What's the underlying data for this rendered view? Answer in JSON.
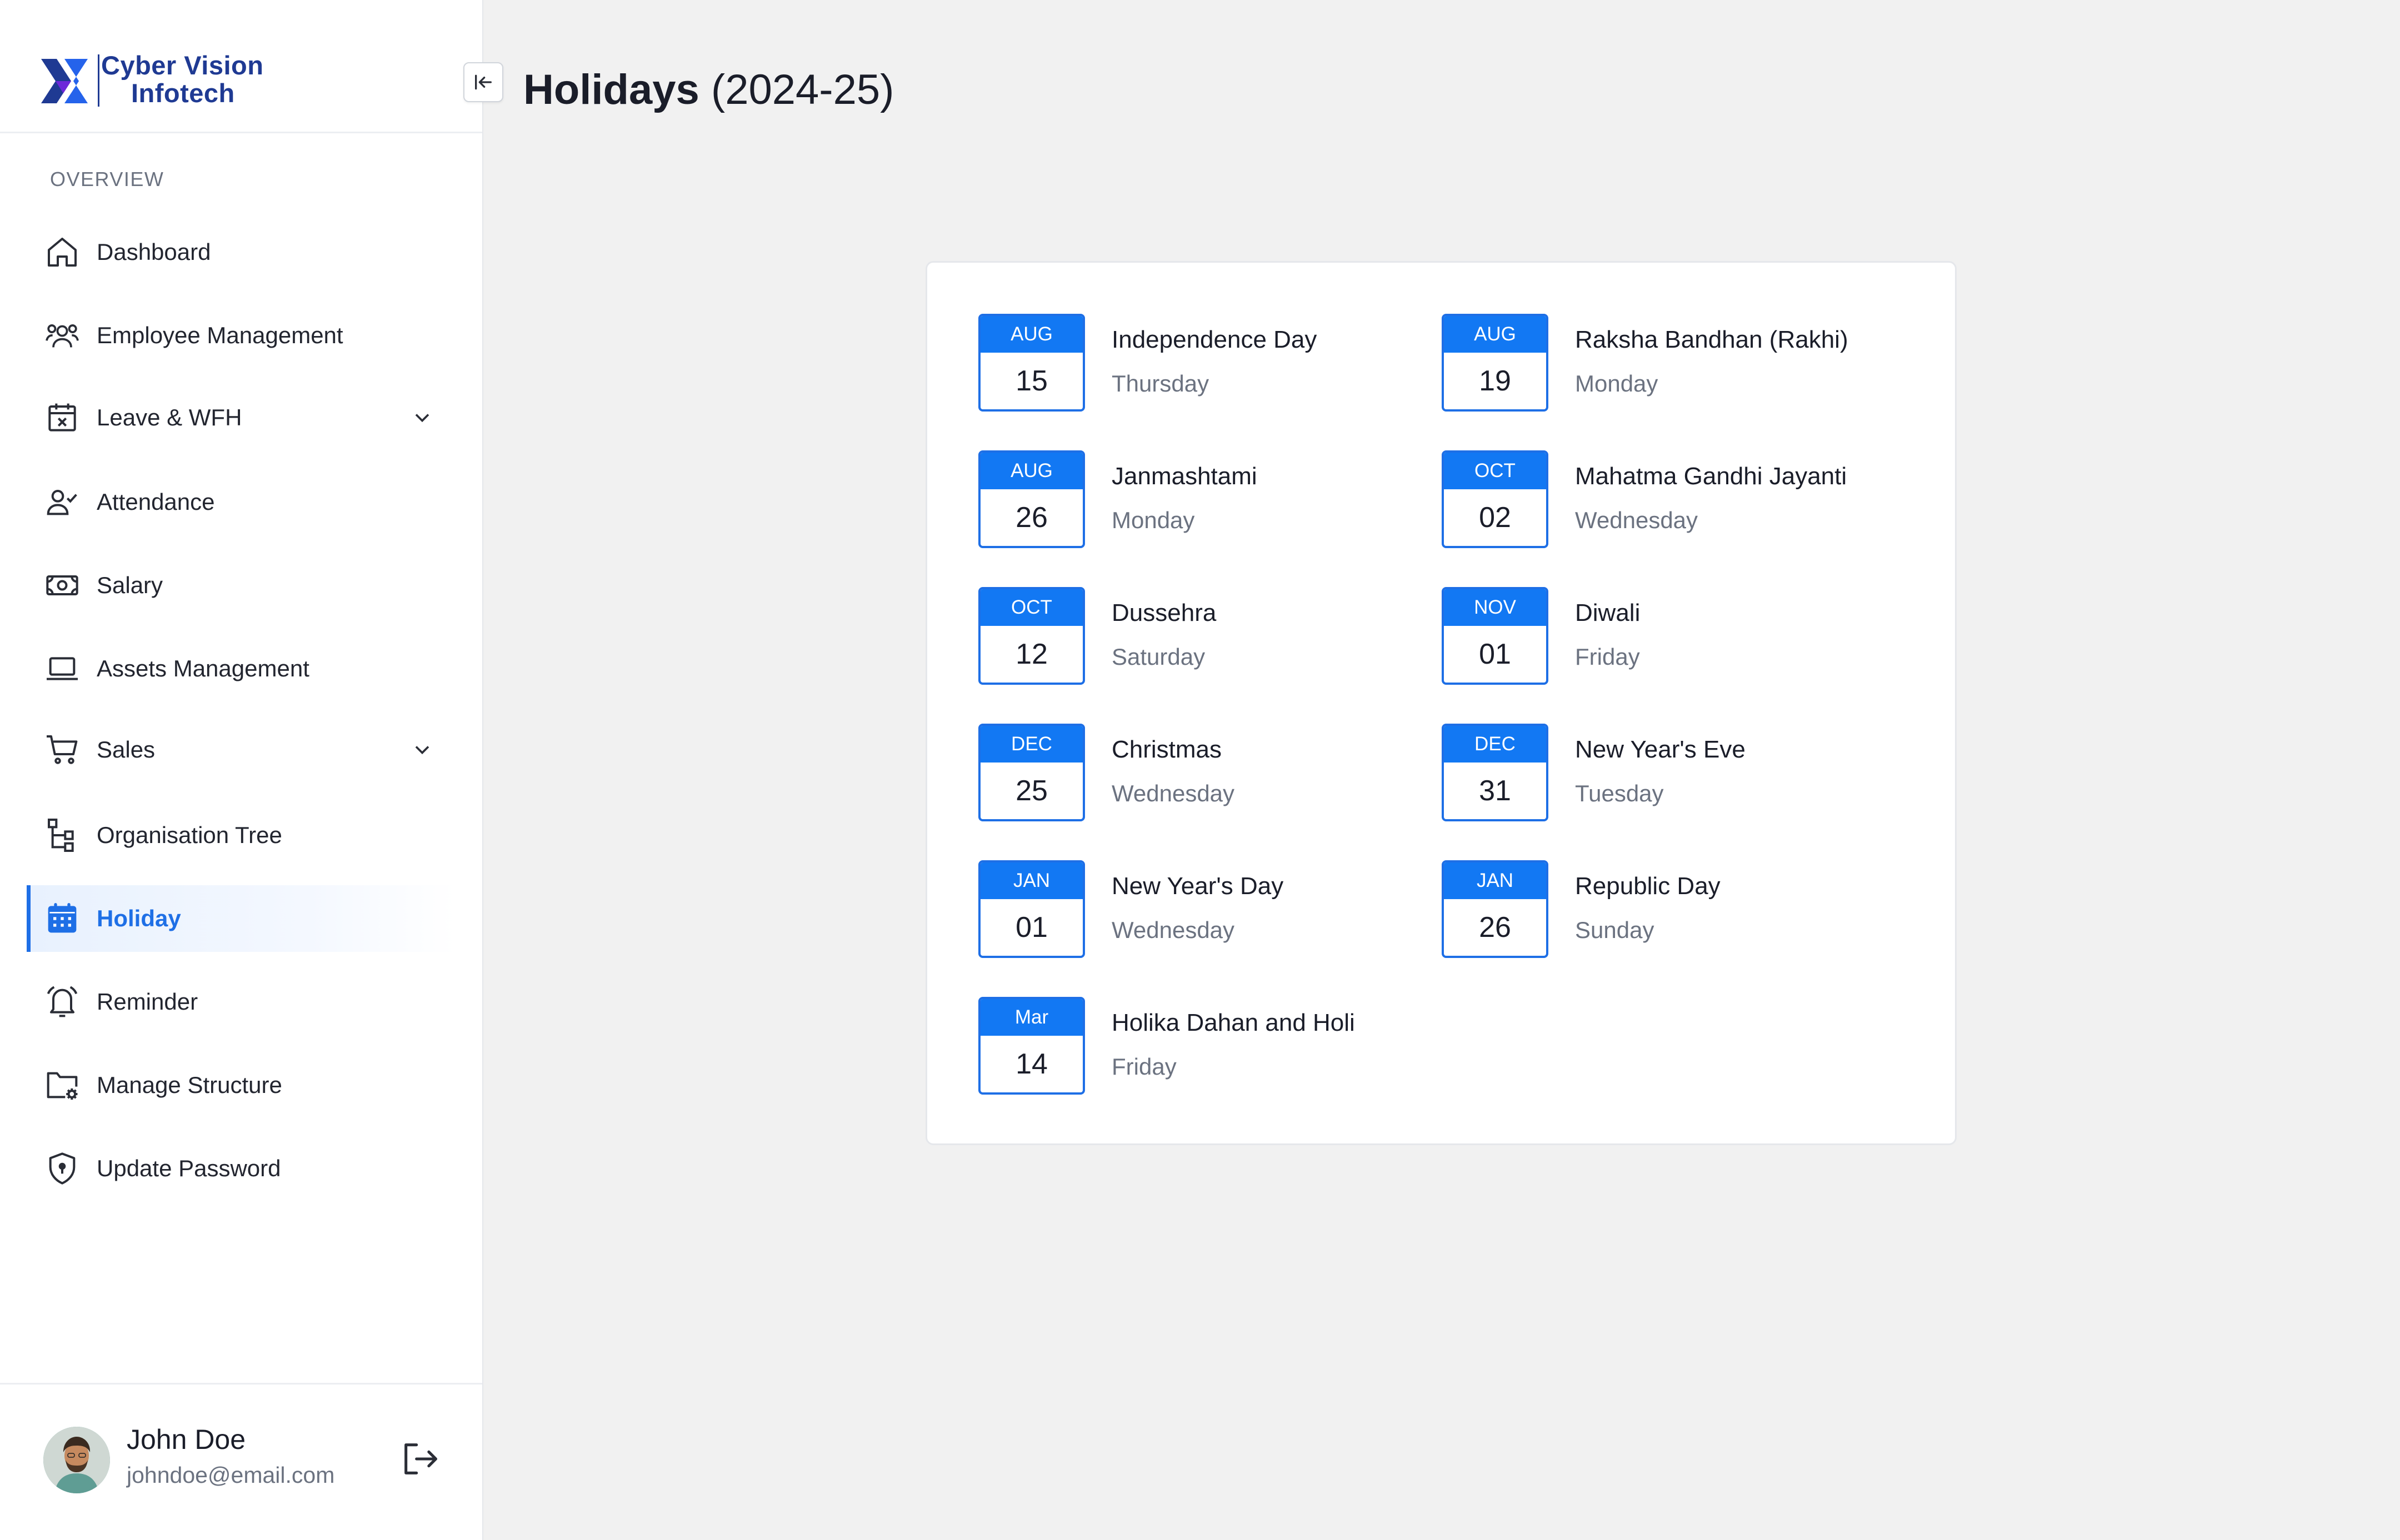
{
  "brand": {
    "line1": "Cyber Vision",
    "line2": "Infotech"
  },
  "sidebar": {
    "section_label": "OVERVIEW",
    "items": [
      {
        "label": "Dashboard",
        "icon": "home-icon"
      },
      {
        "label": "Employee Management",
        "icon": "users-icon"
      },
      {
        "label": "Leave & WFH",
        "icon": "calendar-x-icon",
        "expandable": true
      },
      {
        "label": "Attendance",
        "icon": "user-check-icon"
      },
      {
        "label": "Salary",
        "icon": "banknote-icon"
      },
      {
        "label": "Assets Management",
        "icon": "laptop-icon"
      },
      {
        "label": "Sales",
        "icon": "cart-icon",
        "expandable": true
      },
      {
        "label": "Organisation Tree",
        "icon": "tree-icon"
      },
      {
        "label": "Holiday",
        "icon": "calendar-icon",
        "active": true
      },
      {
        "label": "Reminder",
        "icon": "bell-icon"
      },
      {
        "label": "Manage Structure",
        "icon": "folder-gear-icon"
      },
      {
        "label": "Update Password",
        "icon": "shield-icon"
      }
    ]
  },
  "user": {
    "name": "John Doe",
    "email": "johndoe@email.com"
  },
  "page": {
    "title_bold": "Holidays",
    "title_light": "(2024-25)"
  },
  "holidays": [
    {
      "month": "AUG",
      "day": "15",
      "name": "Independence Day",
      "weekday": "Thursday"
    },
    {
      "month": "AUG",
      "day": "19",
      "name": "Raksha Bandhan (Rakhi)",
      "weekday": "Monday"
    },
    {
      "month": "AUG",
      "day": "26",
      "name": "Janmashtami",
      "weekday": "Monday"
    },
    {
      "month": "OCT",
      "day": "02",
      "name": "Mahatma Gandhi Jayanti",
      "weekday": "Wednesday"
    },
    {
      "month": "OCT",
      "day": "12",
      "name": "Dussehra",
      "weekday": "Saturday"
    },
    {
      "month": "NOV",
      "day": "01",
      "name": "Diwali",
      "weekday": "Friday"
    },
    {
      "month": "DEC",
      "day": "25",
      "name": "Christmas",
      "weekday": "Wednesday"
    },
    {
      "month": "DEC",
      "day": "31",
      "name": "New Year's Eve",
      "weekday": "Tuesday"
    },
    {
      "month": "JAN",
      "day": "01",
      "name": "New Year's Day",
      "weekday": "Wednesday"
    },
    {
      "month": "JAN",
      "day": "26",
      "name": "Republic Day",
      "weekday": "Sunday"
    },
    {
      "month": "Mar",
      "day": "14",
      "name": "Holika Dahan and Holi",
      "weekday": "Friday"
    }
  ],
  "colors": {
    "accent": "#1278f3",
    "active_text": "#1e6fe6",
    "brand": "#1f3a93",
    "background": "#f1f1f1"
  }
}
